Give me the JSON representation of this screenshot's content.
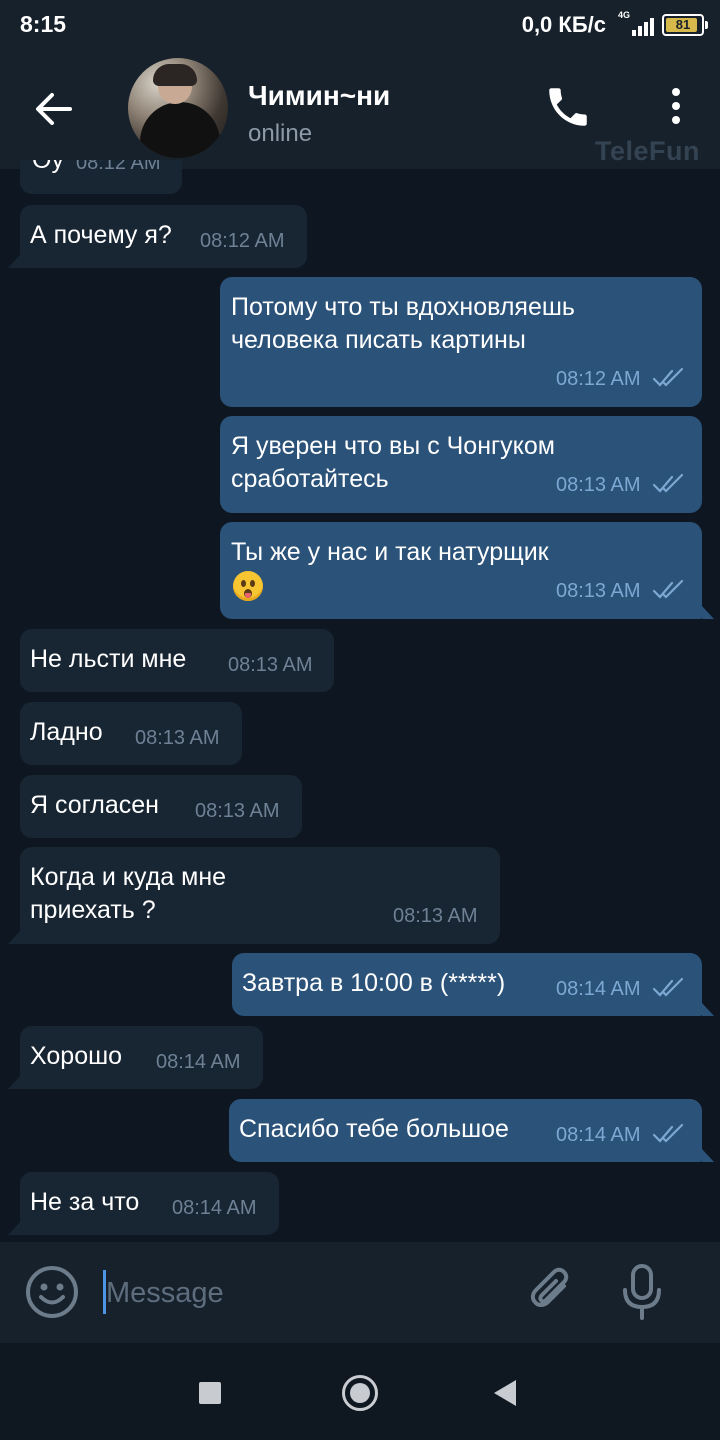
{
  "status_bar": {
    "time": "8:15",
    "net_speed": "0,0 КБ/с",
    "network_type": "4G",
    "battery": "81"
  },
  "header": {
    "chat_name": "Чимин~ни",
    "status": "online",
    "watermark": "TeleFun",
    "icons": [
      "back-arrow-icon",
      "avatar",
      "phone-icon",
      "more-vertical-icon"
    ]
  },
  "messages": [
    {
      "dir": "in",
      "text": "А почему я?",
      "time": "08:12 AM"
    },
    {
      "dir": "out",
      "text": "Потому что ты вдохновляешь\nчеловека писать картины",
      "time": "08:12 AM",
      "read": true
    },
    {
      "dir": "out",
      "text": "Я уверен что вы с Чонгуком\nсработайтесь",
      "time": "08:13 AM",
      "read": true
    },
    {
      "dir": "out",
      "text": "Ты же у нас и так натурщик",
      "emoji": "face-with-open-mouth-tongue",
      "time": "08:13 AM",
      "read": true
    },
    {
      "dir": "in",
      "text": "Не льсти мне",
      "time": "08:13 AM"
    },
    {
      "dir": "in",
      "text": "Ладно",
      "time": "08:13 AM"
    },
    {
      "dir": "in",
      "text": "Я согласен",
      "time": "08:13 AM"
    },
    {
      "dir": "in",
      "text": "Когда и куда мне\nприехать ?",
      "time": "08:13 AM"
    },
    {
      "dir": "out",
      "text": "Завтра в 10:00 в (*****)",
      "time": "08:14 AM",
      "read": true
    },
    {
      "dir": "in",
      "text": "Хорошо",
      "time": "08:14 AM"
    },
    {
      "dir": "out",
      "text": "Спасибо тебе большое",
      "time": "08:14 AM",
      "read": true
    },
    {
      "dir": "in",
      "text": "Не за что",
      "time": "08:14 AM"
    }
  ],
  "input": {
    "placeholder": "Message",
    "icons": [
      "emoji-icon",
      "attach-paperclip-icon",
      "microphone-icon"
    ]
  },
  "navbar": {
    "icons": [
      "recent-apps-icon",
      "home-icon",
      "back-triangle-icon"
    ]
  },
  "colors": {
    "background": "#0e1621",
    "header": "#17212b",
    "incoming_bubble": "#182533",
    "outgoing_bubble": "#2b5278",
    "time_outgoing": "#7da8d3",
    "caret": "#4d96e5"
  }
}
